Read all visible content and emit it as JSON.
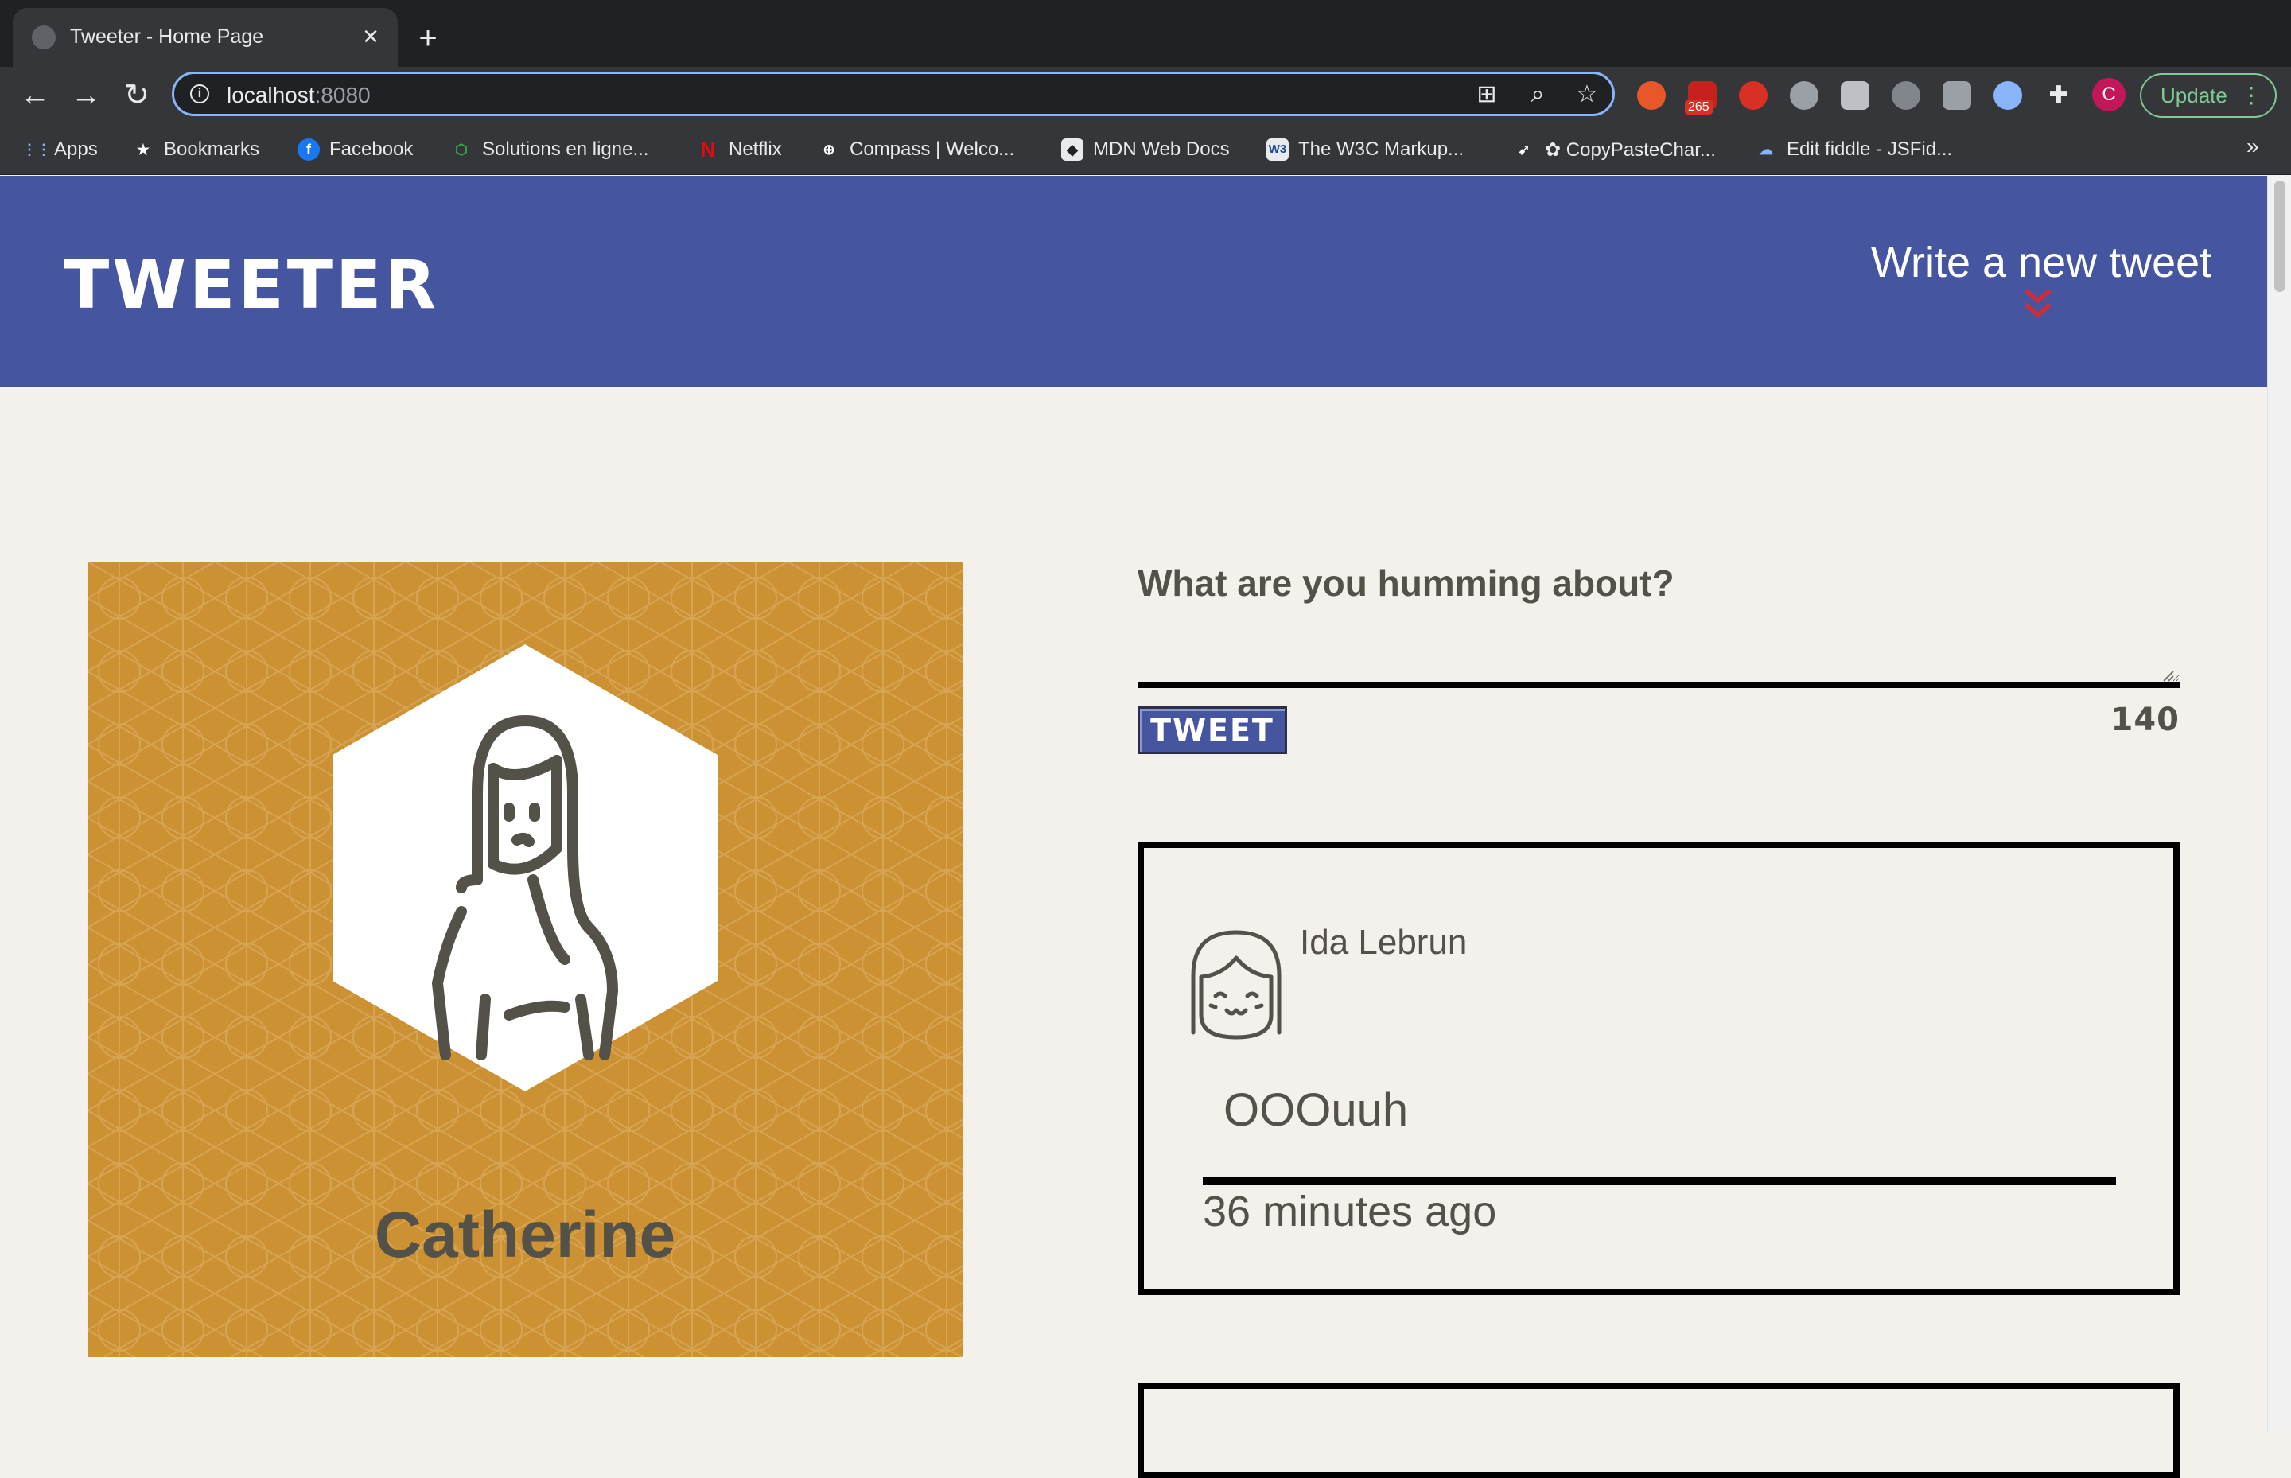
{
  "browser": {
    "tab_title": "Tweeter - Home Page",
    "url_host": "localhost",
    "url_port": ":8080",
    "extension_badge": "265",
    "profile_initial": "C",
    "update_label": "Update",
    "bookmarks": [
      {
        "label": "Apps",
        "icon": "apps-grid-icon"
      },
      {
        "label": "Bookmarks",
        "icon": "star-icon"
      },
      {
        "label": "Facebook",
        "icon": "facebook-icon"
      },
      {
        "label": "Solutions en ligne...",
        "icon": "hexagon-icon"
      },
      {
        "label": "Netflix",
        "icon": "netflix-icon"
      },
      {
        "label": "Compass | Welco...",
        "icon": "compass-icon"
      },
      {
        "label": "MDN Web Docs",
        "icon": "mdn-icon"
      },
      {
        "label": "The W3C Markup...",
        "icon": "w3c-icon"
      },
      {
        "label": "✿ CopyPasteChar...",
        "icon": "cursor-icon"
      },
      {
        "label": "Edit fiddle - JSFid...",
        "icon": "jsfiddle-icon"
      }
    ],
    "overflow_label": "»"
  },
  "header": {
    "logo": "TWEETER",
    "write_link": "Write a new tweet"
  },
  "profile": {
    "name": "Catherine"
  },
  "composer": {
    "label": "What are you humming about?",
    "value": "",
    "button_label": "TWEET",
    "counter": "140"
  },
  "tweets": [
    {
      "author": "Ida Lebrun",
      "text": "OOOuuh",
      "time": "36 minutes ago"
    }
  ],
  "colors": {
    "header_bg": "#4555a0",
    "page_bg": "#f4f1ec",
    "profile_card_bg": "#cc9133",
    "text_gray": "#545149",
    "chevron_red": "#c62f3d"
  }
}
